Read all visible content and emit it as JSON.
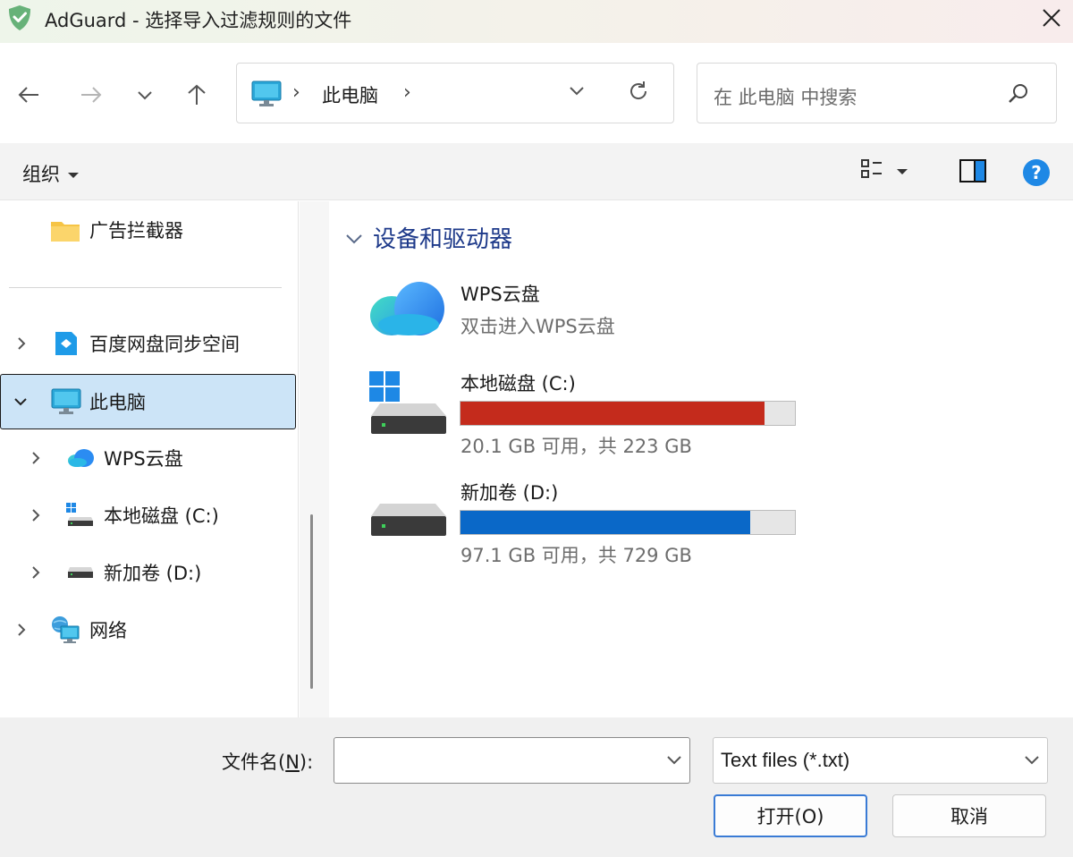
{
  "window": {
    "title": "AdGuard - 选择导入过滤规则的文件"
  },
  "nav": {
    "address_crumb": "此电脑",
    "search_placeholder": "在 此电脑 中搜索"
  },
  "toolbar": {
    "organize_label": "组织"
  },
  "sidebar": {
    "items": [
      {
        "label": "广告拦截器",
        "icon": "folder-icon"
      },
      {
        "label": "百度网盘同步空间",
        "icon": "baidu-netdisk-icon"
      },
      {
        "label": "此电脑",
        "icon": "computer-icon",
        "selected": true
      },
      {
        "label": "WPS云盘",
        "icon": "wps-cloud-icon"
      },
      {
        "label": "本地磁盘 (C:)",
        "icon": "windows-drive-icon"
      },
      {
        "label": "新加卷 (D:)",
        "icon": "drive-icon"
      },
      {
        "label": "网络",
        "icon": "network-icon"
      }
    ]
  },
  "main": {
    "group_title": "设备和驱动器",
    "items": [
      {
        "name": "WPS云盘",
        "subtitle": "双击进入WPS云盘",
        "icon": "wps-cloud-icon"
      },
      {
        "name": "本地磁盘 (C:)",
        "subtitle": "20.1 GB 可用，共 223 GB",
        "used_fraction": 0.91,
        "bar_color": "#c42b1c",
        "icon": "windows-drive-icon"
      },
      {
        "name": "新加卷 (D:)",
        "subtitle": "97.1 GB 可用，共 729 GB",
        "used_fraction": 0.867,
        "bar_color": "#0a68c8",
        "icon": "drive-icon"
      }
    ]
  },
  "footer": {
    "filename_label_pre": "文件名(",
    "filename_label_key": "N",
    "filename_label_post": "):",
    "filename_value": "",
    "filter_value": "Text files (*.txt)",
    "open_label": "打开(O)",
    "cancel_label": "取消"
  },
  "colors": {
    "accent": "#1e3a8a",
    "selection": "#cce4f7",
    "c_drive_bar": "#c42b1c",
    "d_drive_bar": "#0a68c8",
    "help": "#1e88e5"
  }
}
